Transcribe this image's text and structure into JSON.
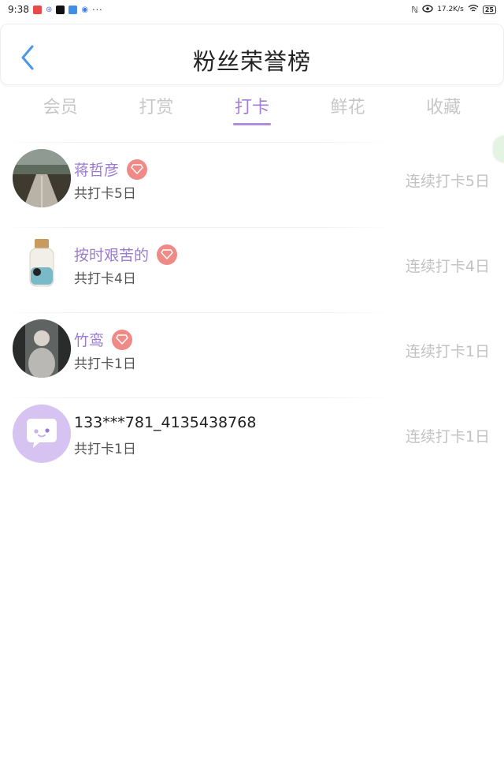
{
  "status_bar": {
    "time": "9:38",
    "network_speed": "17.2K/s",
    "battery": "25",
    "overflow": "···"
  },
  "header": {
    "title": "粉丝荣誉榜"
  },
  "tabs": [
    {
      "label": "会员",
      "active": false
    },
    {
      "label": "打赏",
      "active": false
    },
    {
      "label": "打卡",
      "active": true
    },
    {
      "label": "鲜花",
      "active": false
    },
    {
      "label": "收藏",
      "active": false
    }
  ],
  "fans": [
    {
      "name": "蒋哲彦",
      "total": "共打卡5日",
      "streak": "连续打卡5日",
      "vip": true
    },
    {
      "name": "按时艰苦的",
      "total": "共打卡4日",
      "streak": "连续打卡4日",
      "vip": true
    },
    {
      "name": "竹鸾",
      "total": "共打卡1日",
      "streak": "连续打卡1日",
      "vip": true
    },
    {
      "name": "133***781_4135438768",
      "total": "共打卡1日",
      "streak": "连续打卡1日",
      "vip": false
    }
  ],
  "colors": {
    "accent": "#a47fd3",
    "vip_badge": "#f08a86",
    "inactive_tab": "#c7c7c7"
  }
}
